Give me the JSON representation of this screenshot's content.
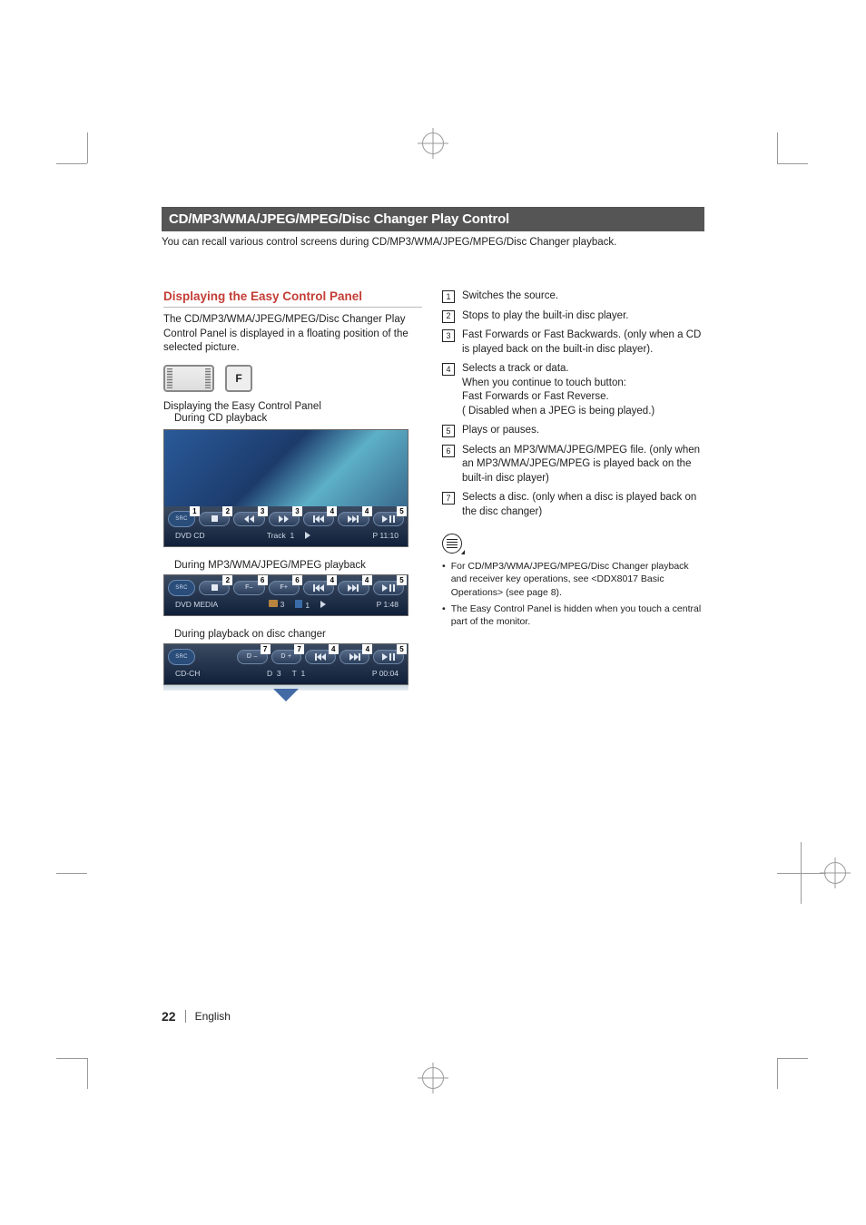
{
  "header": {
    "title": "CD/MP3/WMA/JPEG/MPEG/Disc Changer Play Control"
  },
  "intro": "You can recall various control screens during CD/MP3/WMA/JPEG/MPEG/Disc Changer playback.",
  "left": {
    "heading": "Displaying the Easy Control Panel",
    "paragraph": "The CD/MP3/WMA/JPEG/MPEG/Disc Changer Play Control Panel is displayed in a floating position of the selected picture.",
    "fnc_label": "F",
    "section_label_1": "Displaying the Easy Control Panel",
    "section_label_1b": "During CD playback",
    "section_label_2": "During MP3/WMA/JPEG/MPEG playback",
    "section_label_3": "During playback on disc changer",
    "panels": {
      "src_label": "SRC",
      "cd": {
        "source": "DVD CD",
        "track_label": "Track",
        "track_num": "1",
        "time": "P 11:10",
        "callouts": {
          "src": "1",
          "stop": "2",
          "rew": "3",
          "fwd": "3",
          "prev": "4",
          "next": "4",
          "play": "5"
        }
      },
      "mp3": {
        "source": "DVD MEDIA",
        "folder": "3",
        "file": "1",
        "time": "P 1:48",
        "callouts": {
          "stop": "2",
          "fminus": "6",
          "fplus": "6",
          "prev": "4",
          "next": "4",
          "play": "5"
        }
      },
      "changer": {
        "source": "CD-CH",
        "disc_label": "D",
        "disc": "3",
        "track_label": "T",
        "track": "1",
        "time": "P 00:04",
        "callouts": {
          "dminus": "7",
          "dplus": "7",
          "prev": "4",
          "next": "4",
          "play": "5"
        }
      }
    }
  },
  "right": {
    "items": [
      {
        "n": "1",
        "text": "Switches the source."
      },
      {
        "n": "2",
        "text": "Stops to play the built-in disc player."
      },
      {
        "n": "3",
        "text": "Fast Forwards or Fast Backwards. (only when a CD is played back on the built-in disc player)."
      },
      {
        "n": "4",
        "text": "Selects a track or data.\nWhen you continue to touch button:\nFast Forwards or Fast Reverse.\n( Disabled when a JPEG is being played.)"
      },
      {
        "n": "5",
        "text": "Plays or pauses."
      },
      {
        "n": "6",
        "text": "Selects an MP3/WMA/JPEG/MPEG file. (only when an MP3/WMA/JPEG/MPEG is played back on the built-in disc player)"
      },
      {
        "n": "7",
        "text": "Selects a disc. (only when a disc is played back on the disc changer)"
      }
    ],
    "notes": [
      "For CD/MP3/WMA/JPEG/MPEG/Disc Changer playback and receiver key operations, see <DDX8017 Basic Operations> (see page 8).",
      "The Easy Control Panel is hidden when you touch a central part of the monitor."
    ]
  },
  "footer": {
    "page": "22",
    "lang": "English"
  },
  "chart_data": {
    "type": "table",
    "title": "Easy Control Panel status examples",
    "rows": [
      {
        "mode": "DVD CD",
        "field1_label": "Track",
        "field1": 1,
        "field2_label": "",
        "field2": null,
        "time": "P 11:10"
      },
      {
        "mode": "DVD MEDIA",
        "field1_label": "Folder",
        "field1": 3,
        "field2_label": "File",
        "field2": 1,
        "time": "P 1:48"
      },
      {
        "mode": "CD-CH",
        "field1_label": "D",
        "field1": 3,
        "field2_label": "T",
        "field2": 1,
        "time": "P 00:04"
      }
    ],
    "callout_legend": {
      "1": "Switches the source.",
      "2": "Stops to play the built-in disc player.",
      "3": "Fast Forwards or Fast Backwards (CD on built-in player).",
      "4": "Selects a track or data; hold = Fast Forward/Reverse; disabled for JPEG.",
      "5": "Plays or pauses.",
      "6": "Selects an MP3/WMA/JPEG/MPEG file (built-in player).",
      "7": "Selects a disc (disc changer)."
    }
  }
}
